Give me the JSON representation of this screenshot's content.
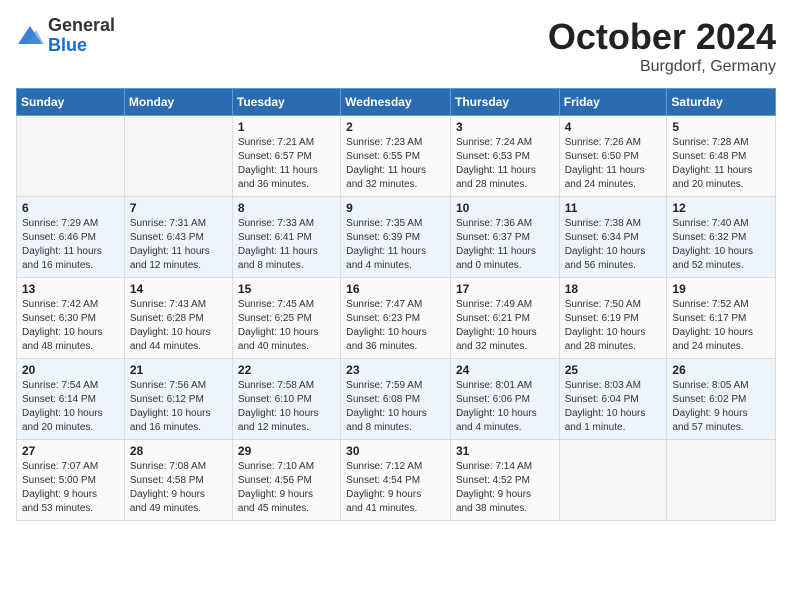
{
  "logo": {
    "general": "General",
    "blue": "Blue"
  },
  "header": {
    "month": "October 2024",
    "location": "Burgdorf, Germany"
  },
  "weekdays": [
    "Sunday",
    "Monday",
    "Tuesday",
    "Wednesday",
    "Thursday",
    "Friday",
    "Saturday"
  ],
  "weeks": [
    [
      {
        "day": "",
        "info": ""
      },
      {
        "day": "",
        "info": ""
      },
      {
        "day": "1",
        "info": "Sunrise: 7:21 AM\nSunset: 6:57 PM\nDaylight: 11 hours\nand 36 minutes."
      },
      {
        "day": "2",
        "info": "Sunrise: 7:23 AM\nSunset: 6:55 PM\nDaylight: 11 hours\nand 32 minutes."
      },
      {
        "day": "3",
        "info": "Sunrise: 7:24 AM\nSunset: 6:53 PM\nDaylight: 11 hours\nand 28 minutes."
      },
      {
        "day": "4",
        "info": "Sunrise: 7:26 AM\nSunset: 6:50 PM\nDaylight: 11 hours\nand 24 minutes."
      },
      {
        "day": "5",
        "info": "Sunrise: 7:28 AM\nSunset: 6:48 PM\nDaylight: 11 hours\nand 20 minutes."
      }
    ],
    [
      {
        "day": "6",
        "info": "Sunrise: 7:29 AM\nSunset: 6:46 PM\nDaylight: 11 hours\nand 16 minutes."
      },
      {
        "day": "7",
        "info": "Sunrise: 7:31 AM\nSunset: 6:43 PM\nDaylight: 11 hours\nand 12 minutes."
      },
      {
        "day": "8",
        "info": "Sunrise: 7:33 AM\nSunset: 6:41 PM\nDaylight: 11 hours\nand 8 minutes."
      },
      {
        "day": "9",
        "info": "Sunrise: 7:35 AM\nSunset: 6:39 PM\nDaylight: 11 hours\nand 4 minutes."
      },
      {
        "day": "10",
        "info": "Sunrise: 7:36 AM\nSunset: 6:37 PM\nDaylight: 11 hours\nand 0 minutes."
      },
      {
        "day": "11",
        "info": "Sunrise: 7:38 AM\nSunset: 6:34 PM\nDaylight: 10 hours\nand 56 minutes."
      },
      {
        "day": "12",
        "info": "Sunrise: 7:40 AM\nSunset: 6:32 PM\nDaylight: 10 hours\nand 52 minutes."
      }
    ],
    [
      {
        "day": "13",
        "info": "Sunrise: 7:42 AM\nSunset: 6:30 PM\nDaylight: 10 hours\nand 48 minutes."
      },
      {
        "day": "14",
        "info": "Sunrise: 7:43 AM\nSunset: 6:28 PM\nDaylight: 10 hours\nand 44 minutes."
      },
      {
        "day": "15",
        "info": "Sunrise: 7:45 AM\nSunset: 6:25 PM\nDaylight: 10 hours\nand 40 minutes."
      },
      {
        "day": "16",
        "info": "Sunrise: 7:47 AM\nSunset: 6:23 PM\nDaylight: 10 hours\nand 36 minutes."
      },
      {
        "day": "17",
        "info": "Sunrise: 7:49 AM\nSunset: 6:21 PM\nDaylight: 10 hours\nand 32 minutes."
      },
      {
        "day": "18",
        "info": "Sunrise: 7:50 AM\nSunset: 6:19 PM\nDaylight: 10 hours\nand 28 minutes."
      },
      {
        "day": "19",
        "info": "Sunrise: 7:52 AM\nSunset: 6:17 PM\nDaylight: 10 hours\nand 24 minutes."
      }
    ],
    [
      {
        "day": "20",
        "info": "Sunrise: 7:54 AM\nSunset: 6:14 PM\nDaylight: 10 hours\nand 20 minutes."
      },
      {
        "day": "21",
        "info": "Sunrise: 7:56 AM\nSunset: 6:12 PM\nDaylight: 10 hours\nand 16 minutes."
      },
      {
        "day": "22",
        "info": "Sunrise: 7:58 AM\nSunset: 6:10 PM\nDaylight: 10 hours\nand 12 minutes."
      },
      {
        "day": "23",
        "info": "Sunrise: 7:59 AM\nSunset: 6:08 PM\nDaylight: 10 hours\nand 8 minutes."
      },
      {
        "day": "24",
        "info": "Sunrise: 8:01 AM\nSunset: 6:06 PM\nDaylight: 10 hours\nand 4 minutes."
      },
      {
        "day": "25",
        "info": "Sunrise: 8:03 AM\nSunset: 6:04 PM\nDaylight: 10 hours\nand 1 minute."
      },
      {
        "day": "26",
        "info": "Sunrise: 8:05 AM\nSunset: 6:02 PM\nDaylight: 9 hours\nand 57 minutes."
      }
    ],
    [
      {
        "day": "27",
        "info": "Sunrise: 7:07 AM\nSunset: 5:00 PM\nDaylight: 9 hours\nand 53 minutes."
      },
      {
        "day": "28",
        "info": "Sunrise: 7:08 AM\nSunset: 4:58 PM\nDaylight: 9 hours\nand 49 minutes."
      },
      {
        "day": "29",
        "info": "Sunrise: 7:10 AM\nSunset: 4:56 PM\nDaylight: 9 hours\nand 45 minutes."
      },
      {
        "day": "30",
        "info": "Sunrise: 7:12 AM\nSunset: 4:54 PM\nDaylight: 9 hours\nand 41 minutes."
      },
      {
        "day": "31",
        "info": "Sunrise: 7:14 AM\nSunset: 4:52 PM\nDaylight: 9 hours\nand 38 minutes."
      },
      {
        "day": "",
        "info": ""
      },
      {
        "day": "",
        "info": ""
      }
    ]
  ]
}
